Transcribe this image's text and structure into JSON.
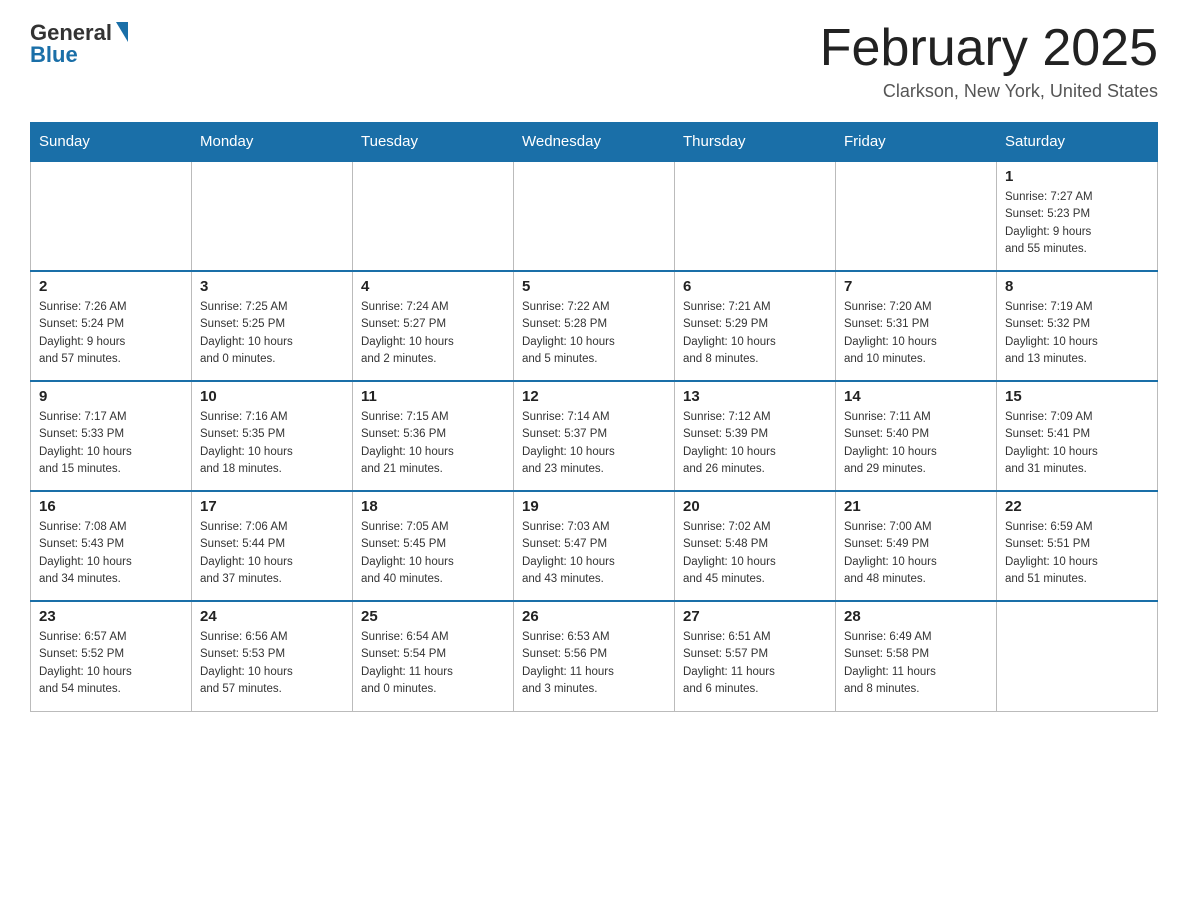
{
  "header": {
    "logo_general": "General",
    "logo_blue": "Blue",
    "title": "February 2025",
    "subtitle": "Clarkson, New York, United States"
  },
  "weekdays": [
    "Sunday",
    "Monday",
    "Tuesday",
    "Wednesday",
    "Thursday",
    "Friday",
    "Saturday"
  ],
  "weeks": [
    [
      {
        "day": "",
        "info": ""
      },
      {
        "day": "",
        "info": ""
      },
      {
        "day": "",
        "info": ""
      },
      {
        "day": "",
        "info": ""
      },
      {
        "day": "",
        "info": ""
      },
      {
        "day": "",
        "info": ""
      },
      {
        "day": "1",
        "info": "Sunrise: 7:27 AM\nSunset: 5:23 PM\nDaylight: 9 hours\nand 55 minutes."
      }
    ],
    [
      {
        "day": "2",
        "info": "Sunrise: 7:26 AM\nSunset: 5:24 PM\nDaylight: 9 hours\nand 57 minutes."
      },
      {
        "day": "3",
        "info": "Sunrise: 7:25 AM\nSunset: 5:25 PM\nDaylight: 10 hours\nand 0 minutes."
      },
      {
        "day": "4",
        "info": "Sunrise: 7:24 AM\nSunset: 5:27 PM\nDaylight: 10 hours\nand 2 minutes."
      },
      {
        "day": "5",
        "info": "Sunrise: 7:22 AM\nSunset: 5:28 PM\nDaylight: 10 hours\nand 5 minutes."
      },
      {
        "day": "6",
        "info": "Sunrise: 7:21 AM\nSunset: 5:29 PM\nDaylight: 10 hours\nand 8 minutes."
      },
      {
        "day": "7",
        "info": "Sunrise: 7:20 AM\nSunset: 5:31 PM\nDaylight: 10 hours\nand 10 minutes."
      },
      {
        "day": "8",
        "info": "Sunrise: 7:19 AM\nSunset: 5:32 PM\nDaylight: 10 hours\nand 13 minutes."
      }
    ],
    [
      {
        "day": "9",
        "info": "Sunrise: 7:17 AM\nSunset: 5:33 PM\nDaylight: 10 hours\nand 15 minutes."
      },
      {
        "day": "10",
        "info": "Sunrise: 7:16 AM\nSunset: 5:35 PM\nDaylight: 10 hours\nand 18 minutes."
      },
      {
        "day": "11",
        "info": "Sunrise: 7:15 AM\nSunset: 5:36 PM\nDaylight: 10 hours\nand 21 minutes."
      },
      {
        "day": "12",
        "info": "Sunrise: 7:14 AM\nSunset: 5:37 PM\nDaylight: 10 hours\nand 23 minutes."
      },
      {
        "day": "13",
        "info": "Sunrise: 7:12 AM\nSunset: 5:39 PM\nDaylight: 10 hours\nand 26 minutes."
      },
      {
        "day": "14",
        "info": "Sunrise: 7:11 AM\nSunset: 5:40 PM\nDaylight: 10 hours\nand 29 minutes."
      },
      {
        "day": "15",
        "info": "Sunrise: 7:09 AM\nSunset: 5:41 PM\nDaylight: 10 hours\nand 31 minutes."
      }
    ],
    [
      {
        "day": "16",
        "info": "Sunrise: 7:08 AM\nSunset: 5:43 PM\nDaylight: 10 hours\nand 34 minutes."
      },
      {
        "day": "17",
        "info": "Sunrise: 7:06 AM\nSunset: 5:44 PM\nDaylight: 10 hours\nand 37 minutes."
      },
      {
        "day": "18",
        "info": "Sunrise: 7:05 AM\nSunset: 5:45 PM\nDaylight: 10 hours\nand 40 minutes."
      },
      {
        "day": "19",
        "info": "Sunrise: 7:03 AM\nSunset: 5:47 PM\nDaylight: 10 hours\nand 43 minutes."
      },
      {
        "day": "20",
        "info": "Sunrise: 7:02 AM\nSunset: 5:48 PM\nDaylight: 10 hours\nand 45 minutes."
      },
      {
        "day": "21",
        "info": "Sunrise: 7:00 AM\nSunset: 5:49 PM\nDaylight: 10 hours\nand 48 minutes."
      },
      {
        "day": "22",
        "info": "Sunrise: 6:59 AM\nSunset: 5:51 PM\nDaylight: 10 hours\nand 51 minutes."
      }
    ],
    [
      {
        "day": "23",
        "info": "Sunrise: 6:57 AM\nSunset: 5:52 PM\nDaylight: 10 hours\nand 54 minutes."
      },
      {
        "day": "24",
        "info": "Sunrise: 6:56 AM\nSunset: 5:53 PM\nDaylight: 10 hours\nand 57 minutes."
      },
      {
        "day": "25",
        "info": "Sunrise: 6:54 AM\nSunset: 5:54 PM\nDaylight: 11 hours\nand 0 minutes."
      },
      {
        "day": "26",
        "info": "Sunrise: 6:53 AM\nSunset: 5:56 PM\nDaylight: 11 hours\nand 3 minutes."
      },
      {
        "day": "27",
        "info": "Sunrise: 6:51 AM\nSunset: 5:57 PM\nDaylight: 11 hours\nand 6 minutes."
      },
      {
        "day": "28",
        "info": "Sunrise: 6:49 AM\nSunset: 5:58 PM\nDaylight: 11 hours\nand 8 minutes."
      },
      {
        "day": "",
        "info": ""
      }
    ]
  ]
}
